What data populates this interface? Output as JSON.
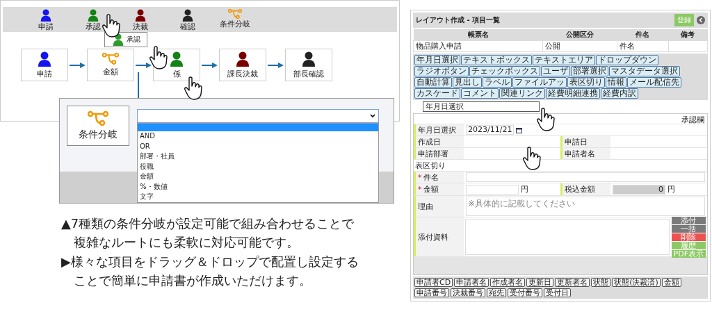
{
  "flow_editor": {
    "palette": [
      {
        "label": "申請",
        "kind": "person",
        "color": "#1414f0"
      },
      {
        "label": "承認",
        "kind": "person",
        "color": "#148214"
      },
      {
        "label": "決裁",
        "kind": "person",
        "color": "#7a0000"
      },
      {
        "label": "確認",
        "kind": "person",
        "color": "#222222"
      },
      {
        "label": "条件分岐",
        "kind": "branch",
        "color": "#f39800"
      }
    ],
    "dragged_item": {
      "label": "承認",
      "kind": "person",
      "color": "#2e9a2e"
    },
    "nodes": [
      {
        "label": "申請",
        "kind": "person",
        "color": "#1414f0"
      },
      {
        "label": "金額",
        "kind": "branch",
        "color": "#f39800"
      },
      {
        "label": "係",
        "kind": "person",
        "color": "#148214"
      },
      {
        "label": "課長決裁",
        "kind": "person",
        "color": "#7a0000"
      },
      {
        "label": "部長確認",
        "kind": "person",
        "color": "#222222"
      }
    ]
  },
  "condition_dialog": {
    "node_label": "条件分岐",
    "select": {
      "expanded": true
    },
    "options": [
      "AND",
      "OR",
      "部署・社員",
      "役職",
      "金額",
      "%・数値",
      "文字"
    ]
  },
  "caption": [
    "▲7種類の条件分岐が設定可能で組み合わせることで複雑なルートにも柔軟に対応可能です。",
    "▶様々な項目をドラッグ＆ドロップで配置し設定することで簡単に申請書が作成いただけます。"
  ],
  "layout_editor": {
    "title": "レイアウト作成 - 項目一覧",
    "register_button": "登録",
    "header_columns": [
      "帳票名",
      "公開区分",
      "件名",
      "備考"
    ],
    "header_row": [
      "物品購入申請",
      "公開",
      "件名"
    ],
    "field_types": [
      "年月日選択",
      "テキストボックス",
      "テキストエリア",
      "ドロップダウン",
      "ラジオボタン",
      "チェックボックス",
      "ユーザ",
      "部署選択",
      "マスタデータ選択",
      "自動計算",
      "見出し",
      "ラベル",
      "ファイルアッ",
      "表区切り",
      "情報",
      "メール配信先",
      "カスケード",
      "コメント",
      "関連リンク",
      "経費明細連携",
      "経費内訳"
    ],
    "dragged_field": "年月日選択",
    "approval_label": "承認欄",
    "rows": [
      {
        "kind": "date",
        "label": "年月日選択",
        "value": "2023/11/21"
      },
      {
        "kind": "pair",
        "labels": [
          "作成日",
          "申請日"
        ]
      },
      {
        "kind": "pair",
        "labels": [
          "申請部署",
          "申請者名"
        ]
      },
      {
        "kind": "separator",
        "label": "表区切り"
      },
      {
        "kind": "text",
        "label": "件名",
        "mark": "*"
      },
      {
        "kind": "amount",
        "label": "金額",
        "mark": "*",
        "unit": "円",
        "label2": "税込金額",
        "value2": "0",
        "unit2": "円"
      },
      {
        "kind": "textarea",
        "label": "理由",
        "placeholder": "※具体的に記載してください"
      },
      {
        "kind": "attachment",
        "label": "添付資料",
        "buttons": [
          {
            "label": "添付",
            "color": "#7a7a7a"
          },
          {
            "label": "一括",
            "color": "#7a7a7a"
          },
          {
            "label": "削除",
            "color": "#f05050"
          },
          {
            "label": "履歴",
            "color": "#8cc864"
          },
          {
            "label": "PDF表示",
            "color": "#8cc864"
          }
        ]
      }
    ],
    "tags": [
      "申請者CD",
      "申請者名",
      "作成者名",
      "更新日",
      "更新者名",
      "状態",
      "状態(決裁済)",
      "金額",
      "申請番号",
      "決裁番号",
      "宛先",
      "受付番号",
      "受付日"
    ]
  }
}
